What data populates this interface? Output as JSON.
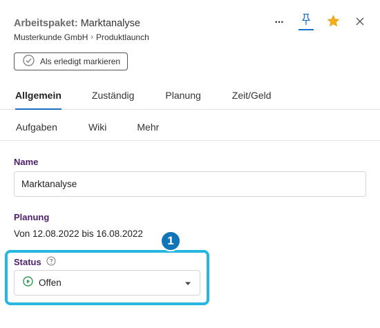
{
  "header": {
    "title_prefix": "Arbeitspaket:",
    "title": "Marktanalyse",
    "breadcrumb": {
      "customer": "Musterkunde GmbH",
      "separator": "›",
      "project": "Produktlaunch"
    },
    "actions": [
      "more-icon",
      "pin-icon",
      "star-icon",
      "close-icon"
    ],
    "more_label": "···"
  },
  "done_button": {
    "label": "Als erledigt markieren"
  },
  "tabs_row1": [
    {
      "label": "Allgemein",
      "active": true
    },
    {
      "label": "Zuständig",
      "active": false
    },
    {
      "label": "Planung",
      "active": false
    },
    {
      "label": "Zeit/Geld",
      "active": false
    }
  ],
  "tabs_row2": [
    {
      "label": "Aufgaben"
    },
    {
      "label": "Wiki"
    },
    {
      "label": "Mehr"
    }
  ],
  "form": {
    "name_label": "Name",
    "name_value": "Marktanalyse",
    "planung_label": "Planung",
    "planung_value": "Von 12.08.2022 bis 16.08.2022",
    "status_label": "Status",
    "status_value": "Offen"
  },
  "callout": {
    "number": "1"
  },
  "colors": {
    "accent": "#1a6fc9",
    "label": "#4b1e6b",
    "star": "#f2b01e",
    "highlight": "#27b6e0",
    "badge": "#0f74b8",
    "status_green": "#2e9e4f"
  }
}
